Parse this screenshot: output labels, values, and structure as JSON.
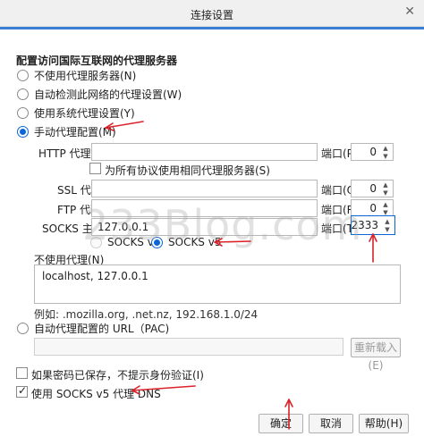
{
  "window": {
    "title": "连接设置"
  },
  "section_title": "配置访问国际互联网的代理服务器",
  "proxy_modes": [
    {
      "label": "不使用代理服务器(N)",
      "selected": false
    },
    {
      "label": "自动检测此网络的代理设置(W)",
      "selected": false
    },
    {
      "label": "使用系统代理设置(Y)",
      "selected": false
    },
    {
      "label": "手动代理配置(M)",
      "selected": true
    }
  ],
  "http": {
    "label": "HTTP 代理(X)",
    "value": "",
    "port_label": "端口(P)",
    "port": "0"
  },
  "share_all": {
    "label": "为所有协议使用相同代理服务器(S)",
    "checked": false
  },
  "ssl": {
    "label": "SSL 代理",
    "value": "",
    "port_label": "端口(O)",
    "port": "0"
  },
  "ftp": {
    "label": "FTP 代理",
    "value": "",
    "port_label": "端口(R)",
    "port": "0"
  },
  "socks": {
    "label": "SOCKS 主机",
    "value": "127.0.0.1",
    "port_label": "端口(T)",
    "port": "2333"
  },
  "socks_versions": [
    {
      "label": "SOCKS v4",
      "selected": false
    },
    {
      "label": "SOCKS v5",
      "selected": true
    }
  ],
  "no_proxy": {
    "label": "不使用代理(N)",
    "value": "localhost, 127.0.0.1",
    "example": "例如: .mozilla.org, .net.nz, 192.168.1.0/24"
  },
  "pac": {
    "label": "自动代理配置的 URL（PAC)",
    "value": "",
    "reload_label": "重新载入(E)"
  },
  "no_prompt_auth": {
    "label": "如果密码已保存，不提示身份验证(I)",
    "checked": false
  },
  "socks_dns": {
    "label": "使用 SOCKS v5 代理 DNS",
    "checked": true
  },
  "buttons": {
    "ok": "确定",
    "cancel": "取消",
    "help": "帮助(H)"
  },
  "watermark": "233Blog.com",
  "colors": {
    "accent": "#0a66d6",
    "annotation_arrow": "#d9222a",
    "title_strip": "#3b7fd4"
  }
}
